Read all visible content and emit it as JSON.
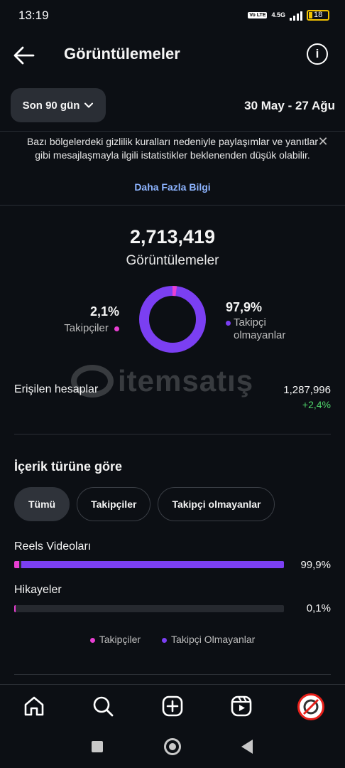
{
  "status_bar": {
    "time": "13:19",
    "volte": "Vo LTE",
    "network": "4.5G",
    "battery": "18"
  },
  "header": {
    "title": "Görüntülemeler",
    "back_icon": "arrow-left-icon",
    "info_icon": "info-icon",
    "info_glyph": "i"
  },
  "filter": {
    "range_label": "Son 90 gün",
    "date_range": "30 May - 27 Ağu"
  },
  "notice": {
    "text": "Bazı bölgelerdeki gizlilik kuralları nedeniyle paylaşımlar ve yanıtlar gibi mesajlaşmayla ilgili istatistikler beklenenden düşük olabilir.",
    "link": "Daha Fazla Bilgi",
    "close_glyph": "✕"
  },
  "summary": {
    "total": "2,713,419",
    "total_label": "Görüntülemeler",
    "followers_pct": "2,1%",
    "followers_label": "Takipçiler",
    "followers_fraction": 0.021,
    "nonfollowers_pct": "97,9%",
    "nonfollowers_label_1": "Takipçi",
    "nonfollowers_label_2": "olmayanlar"
  },
  "watermark": {
    "text": "itemsatış"
  },
  "reach": {
    "label": "Erişilen hesaplar",
    "value": "1,287,996",
    "delta": "+2,4%"
  },
  "content_type": {
    "title": "İçerik türüne göre",
    "chips": [
      "Tümü",
      "Takipçiler",
      "Takipçi olmayanlar"
    ],
    "rows": [
      {
        "label": "Reels Videoları",
        "pct": "99,9%",
        "total_fraction": 0.999,
        "followers_fraction": 0.021
      },
      {
        "label": "Hikayeler",
        "pct": "0,1%",
        "total_fraction": 0.001,
        "followers_fraction": 0.001
      }
    ],
    "legend": [
      "Takipçiler",
      "Takipçi Olmayanlar"
    ]
  },
  "colors": {
    "followers": "#e83fd2",
    "nonfollowers": "#7b3ff2",
    "positive": "#4fd36a"
  },
  "nav": {
    "items": [
      "home-icon",
      "search-icon",
      "create-icon",
      "reels-icon",
      "profile-avatar"
    ]
  }
}
